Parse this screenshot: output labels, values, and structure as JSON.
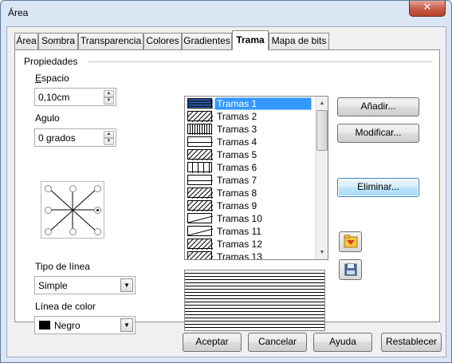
{
  "window": {
    "title": "Área",
    "close": "✕"
  },
  "tabs": [
    {
      "label": "Área"
    },
    {
      "label": "Sombra"
    },
    {
      "label": "Transparencia"
    },
    {
      "label": "Colores"
    },
    {
      "label": "Gradientes"
    },
    {
      "label": "Trama"
    },
    {
      "label": "Mapa de bits"
    }
  ],
  "properties": {
    "section_label": "Propiedades",
    "spacing": {
      "label": "Espacio",
      "value": "0,10cm"
    },
    "angle": {
      "label": "Agulo",
      "value": "0 grados"
    },
    "line_type": {
      "label": "Tipo de línea",
      "value": "Simple"
    },
    "line_color": {
      "label": "Línea de color",
      "value": "Negro",
      "swatch": "#000000"
    }
  },
  "hatch_list": {
    "items": [
      "Tramas 1",
      "Tramas 2",
      "Tramas 3",
      "Tramas 4",
      "Tramas 5",
      "Tramas 6",
      "Tramas 7",
      "Tramas 8",
      "Tramas 9",
      "Tramas 10",
      "Tramas 11",
      "Tramas 12",
      "Tramas 13"
    ],
    "selected": "Tramas 1"
  },
  "side_buttons": {
    "add": "Añadir...",
    "modify": "Modificar...",
    "delete": "Eliminar...",
    "load_icon": "folder-load-icon",
    "save_icon": "save-disk-icon"
  },
  "footer": {
    "ok": "Aceptar",
    "cancel": "Cancelar",
    "help": "Ayuda",
    "reset": "Restablecer"
  },
  "colors": {
    "accent": "#3399ff",
    "window_frame": "#dbe6f4",
    "dialog_bg": "#f0f0f0"
  }
}
